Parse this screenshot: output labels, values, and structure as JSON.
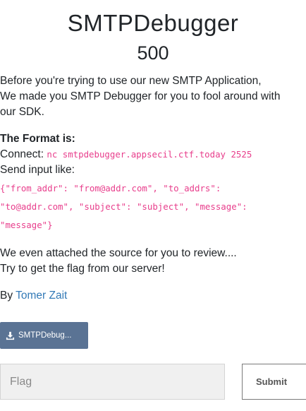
{
  "challenge": {
    "title": "SMTPDebugger",
    "points": "500"
  },
  "description": {
    "intro_line1": "Before you're trying to use our new SMTP Application,",
    "intro_line2": "We made you SMTP Debugger for you to fool around with",
    "intro_line3": "our SDK.",
    "format_heading": "The Format is:",
    "connect_label": "Connect: ",
    "connect_command": "nc smtpdebugger.appsecil.ctf.today 2525",
    "send_label": "Send input like:",
    "input_example_line1": "{\"from_addr\": \"from@addr.com\", \"to_addrs\":",
    "input_example_line2": "\"to@addr.com\", \"subject\": \"subject\", \"message\":",
    "input_example_line3": "\"message\"}",
    "source_line1": "We even attached the source for you to review....",
    "source_line2": "Try to get the flag from our server!",
    "by_label": "By ",
    "author": "Tomer Zait"
  },
  "attachment": {
    "label": "SMTPDebug...",
    "icon": "download-icon"
  },
  "submission": {
    "flag_placeholder": "Flag",
    "flag_value": "",
    "submit_label": "Submit"
  },
  "colors": {
    "code": "#e83e8c",
    "link": "#337ab7",
    "download_button": "#5a7394"
  }
}
